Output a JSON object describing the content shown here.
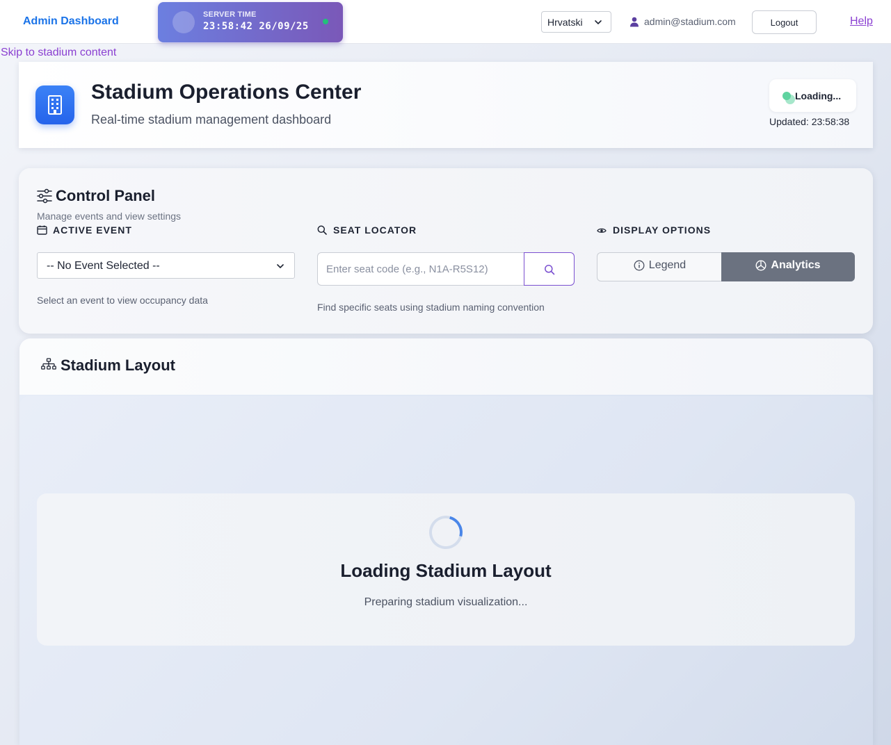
{
  "nav": {
    "brand": "Admin Dashboard",
    "server_time": {
      "label": "SERVER TIME",
      "value": "23:58:42 26/09/25",
      "status_color": "#22c07a"
    },
    "language": {
      "selected": "Hrvatski"
    },
    "user": {
      "email": "admin@stadium.com",
      "icon": "user-icon"
    },
    "logout_label": "Logout",
    "help_label": "Help"
  },
  "skip_link": "Skip to stadium content",
  "header": {
    "icon": "building-icon",
    "title": "Stadium Operations Center",
    "subtitle": "Real-time stadium management dashboard",
    "status_text": "Loading...",
    "updated": "Updated: 23:58:38",
    "accent_color": "#2563eb"
  },
  "control_panel": {
    "title": "Control Panel",
    "subtitle": "Manage events and view settings",
    "active_event": {
      "label": "ACTIVE EVENT",
      "icon": "calendar-icon",
      "selected": "-- No Event Selected --",
      "hint": "Select an event to view occupancy data"
    },
    "seat_locator": {
      "label": "SEAT LOCATOR",
      "icon": "search-icon",
      "value": "",
      "placeholder": "Enter seat code (e.g., N1A-R5S12)",
      "hint": "Find specific seats using stadium naming convention"
    },
    "display_options": {
      "label": "DISPLAY OPTIONS",
      "icon": "eye-icon",
      "legend_label": "Legend",
      "analytics_label": "Analytics",
      "active": "Analytics"
    }
  },
  "stadium_layout": {
    "title": "Stadium Layout",
    "icon": "sitemap-icon",
    "loading_title": "Loading Stadium Layout",
    "loading_subtitle": "Preparing stadium visualization..."
  }
}
